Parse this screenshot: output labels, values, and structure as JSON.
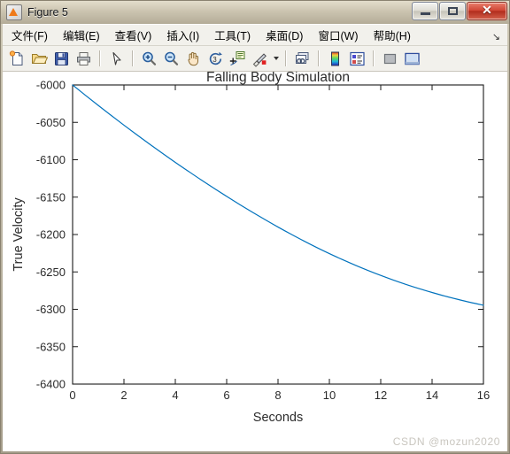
{
  "window": {
    "title": "Figure 5",
    "app_icon": "matlab-figure-icon",
    "controls": {
      "minimize": "–",
      "maximize": "□",
      "close": "✕"
    }
  },
  "menubar": {
    "items": [
      {
        "name": "file",
        "label": "文件(F)"
      },
      {
        "name": "edit",
        "label": "编辑(E)"
      },
      {
        "name": "view",
        "label": "查看(V)"
      },
      {
        "name": "insert",
        "label": "插入(I)"
      },
      {
        "name": "tools",
        "label": "工具(T)"
      },
      {
        "name": "desktop",
        "label": "桌面(D)"
      },
      {
        "name": "window",
        "label": "窗口(W)"
      },
      {
        "name": "help",
        "label": "帮助(H)"
      }
    ],
    "overflow_glyph": "↘"
  },
  "toolbar": {
    "buttons": [
      {
        "name": "new-figure-icon",
        "tip": "New Figure"
      },
      {
        "name": "open-file-icon",
        "tip": "Open File"
      },
      {
        "name": "save-figure-icon",
        "tip": "Save Figure"
      },
      {
        "name": "print-figure-icon",
        "tip": "Print Figure"
      },
      {
        "name": "edit-plot-arrow-icon",
        "tip": "Edit Plot"
      },
      {
        "name": "zoom-in-icon",
        "tip": "Zoom In"
      },
      {
        "name": "zoom-out-icon",
        "tip": "Zoom Out"
      },
      {
        "name": "pan-hand-icon",
        "tip": "Pan"
      },
      {
        "name": "rotate-3d-icon",
        "tip": "Rotate 3D"
      },
      {
        "name": "data-cursor-icon",
        "tip": "Data Cursor"
      },
      {
        "name": "brush-data-icon",
        "tip": "Brush/Select Data"
      },
      {
        "name": "link-plot-icon",
        "tip": "Link Plot"
      },
      {
        "name": "colorbar-icon",
        "tip": "Insert Colorbar"
      },
      {
        "name": "legend-icon",
        "tip": "Insert Legend"
      },
      {
        "name": "hide-plot-tools-icon",
        "tip": "Hide Plot Tools"
      },
      {
        "name": "show-plot-tools-icon",
        "tip": "Show Plot Tools"
      }
    ]
  },
  "watermark": "CSDN @mozun2020",
  "chart_data": {
    "type": "line",
    "title": "Falling Body Simulation",
    "xlabel": "Seconds",
    "ylabel": "True Velocity",
    "xlim": [
      0,
      16
    ],
    "ylim": [
      -6400,
      -6000
    ],
    "xticks": [
      0,
      2,
      4,
      6,
      8,
      10,
      12,
      14,
      16
    ],
    "yticks": [
      -6400,
      -6350,
      -6300,
      -6250,
      -6200,
      -6150,
      -6100,
      -6050,
      -6000
    ],
    "xtick_labels": [
      "0",
      "2",
      "4",
      "6",
      "8",
      "10",
      "12",
      "14",
      "16"
    ],
    "ytick_labels": [
      "-6400",
      "-6350",
      "-6300",
      "-6250",
      "-6200",
      "-6150",
      "-6100",
      "-6050",
      "-6000"
    ],
    "grid": false,
    "legend": null,
    "box": true,
    "line_color": "#0072BD",
    "line_width": 1.2,
    "series": [
      {
        "name": "True Velocity",
        "x": [
          0,
          0.5,
          1,
          1.5,
          2,
          2.5,
          3,
          3.5,
          4,
          4.5,
          5,
          5.5,
          6,
          6.5,
          7,
          7.5,
          8,
          8.5,
          9,
          9.5,
          10,
          10.5,
          11,
          11.5,
          12,
          12.5,
          13,
          13.5,
          14,
          14.5,
          15,
          15.5,
          16
        ],
        "y": [
          -6000.0,
          -6013.8,
          -6027.4,
          -6040.7,
          -6053.8,
          -6066.6,
          -6079.1,
          -6091.4,
          -6103.5,
          -6115.2,
          -6126.8,
          -6138.0,
          -6149.0,
          -6159.7,
          -6170.1,
          -6180.2,
          -6190.0,
          -6199.4,
          -6208.5,
          -6217.2,
          -6225.5,
          -6233.4,
          -6240.9,
          -6248.0,
          -6254.7,
          -6261.0,
          -6266.9,
          -6272.4,
          -6277.5,
          -6282.3,
          -6286.7,
          -6290.8,
          -6294.5
        ]
      }
    ]
  }
}
